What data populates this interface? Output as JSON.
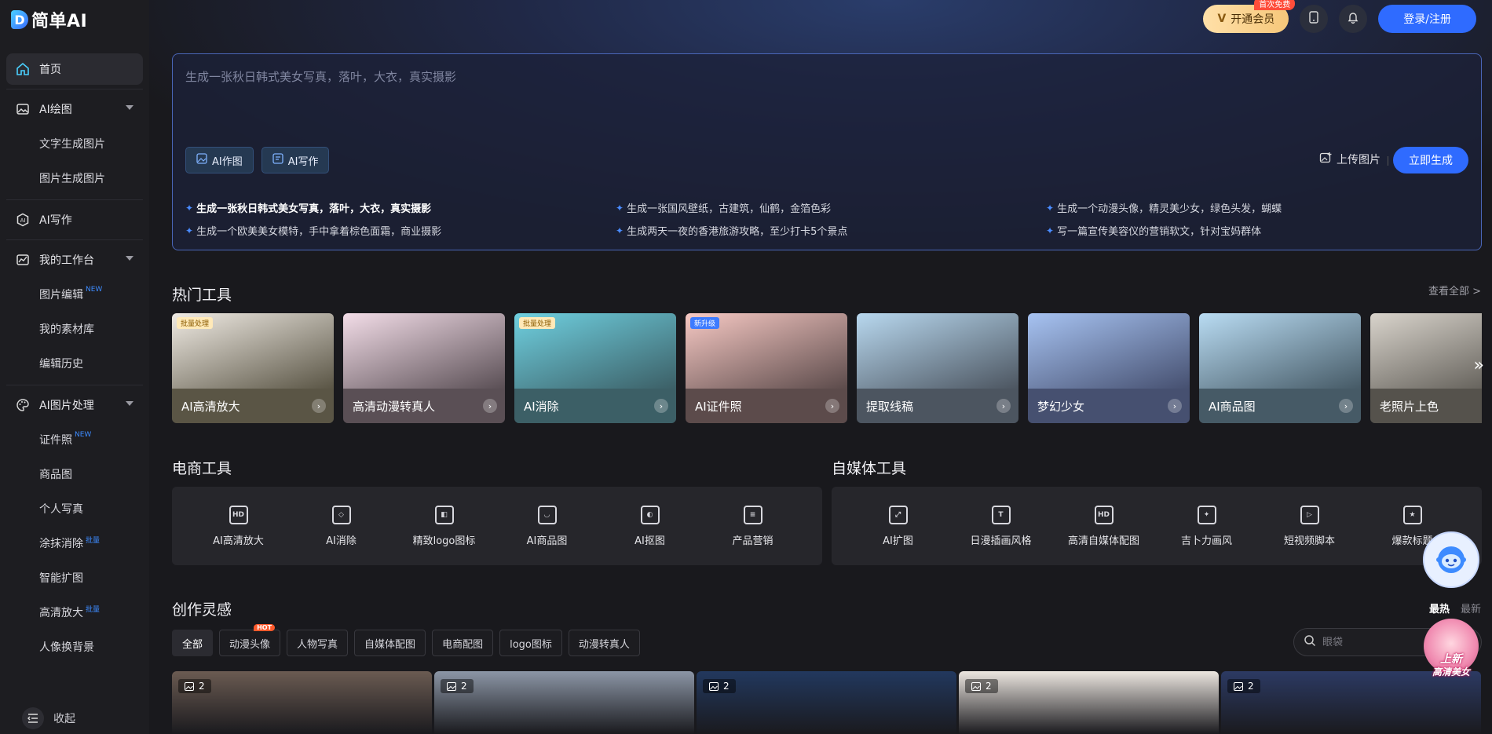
{
  "app": {
    "logo_mark": "D",
    "logo_text": "简单AI"
  },
  "topbar": {
    "vip_label": "开通会员",
    "vip_badge": "首次免费",
    "login_label": "登录/注册"
  },
  "sidebar": {
    "home": "首页",
    "groups": [
      {
        "label": "AI绘图",
        "items": [
          {
            "label": "文字生成图片"
          },
          {
            "label": "图片生成图片"
          }
        ]
      },
      {
        "label": "AI写作"
      },
      {
        "label": "我的工作台",
        "items": [
          {
            "label": "图片编辑",
            "tag": "NEW"
          },
          {
            "label": "我的素材库"
          },
          {
            "label": "编辑历史"
          }
        ]
      },
      {
        "label": "AI图片处理",
        "items": [
          {
            "label": "证件照",
            "tag": "NEW"
          },
          {
            "label": "商品图"
          },
          {
            "label": "个人写真"
          },
          {
            "label": "涂抹消除",
            "tag": "批量"
          },
          {
            "label": "智能扩图"
          },
          {
            "label": "高清放大",
            "tag": "批量"
          },
          {
            "label": "人像换背景"
          }
        ]
      }
    ],
    "collapse_label": "收起"
  },
  "prompt": {
    "placeholder": "生成一张秋日韩式美女写真，落叶，大衣，真实摄影",
    "modes": [
      "AI作图",
      "AI写作"
    ],
    "upload_label": "上传图片",
    "generate_label": "立即生成",
    "suggestions": [
      "生成一张秋日韩式美女写真，落叶，大衣，真实摄影",
      "生成一张国风壁纸，古建筑，仙鹤，金箔色彩",
      "生成一个动漫头像，精灵美少女，绿色头发，蝴蝶",
      "生成一个欧美美女模特，手中拿着棕色面霜，商业摄影",
      "生成两天一夜的香港旅游攻略，至少打卡5个景点",
      "写一篇宣传美容仪的营销软文，针对宝妈群体"
    ]
  },
  "hot_tools": {
    "title": "热门工具",
    "see_all": "查看全部 >",
    "cards": [
      {
        "label": "AI高清放大",
        "badge": "批量处理",
        "bg": "#f0ebe4",
        "band": "#5a5545"
      },
      {
        "label": "高清动漫转真人",
        "badge": "",
        "bg": "#f3dde8",
        "band": "#5a4f55"
      },
      {
        "label": "AI消除",
        "badge": "批量处理",
        "bg": "#6fd0e0",
        "band": "#3c5f66"
      },
      {
        "label": "AI证件照",
        "badge": "新升级",
        "bg": "#f7c9c4",
        "band": "#5c4b4b"
      },
      {
        "label": "提取线稿",
        "badge": "",
        "bg": "#b8d8ef",
        "band": "#4c5560"
      },
      {
        "label": "梦幻少女",
        "badge": "",
        "bg": "#a7c3f2",
        "band": "#465070"
      },
      {
        "label": "AI商品图",
        "badge": "",
        "bg": "#b9dcf3",
        "band": "#465a66"
      },
      {
        "label": "老照片上色",
        "badge": "",
        "bg": "#d9d4cc",
        "band": "#55524c"
      }
    ]
  },
  "ecommerce": {
    "title": "电商工具",
    "items": [
      {
        "label": "AI高清放大",
        "icon": "HD"
      },
      {
        "label": "AI消除",
        "icon": "◇"
      },
      {
        "label": "精致logo图标",
        "icon": "◧"
      },
      {
        "label": "AI商品图",
        "icon": "◡"
      },
      {
        "label": "AI抠图",
        "icon": "◐"
      },
      {
        "label": "产品营销",
        "icon": "≡"
      }
    ]
  },
  "media": {
    "title": "自媒体工具",
    "items": [
      {
        "label": "AI扩图",
        "icon": "⤢"
      },
      {
        "label": "日漫插画风格",
        "icon": "T"
      },
      {
        "label": "高清自媒体配图",
        "icon": "HD"
      },
      {
        "label": "吉卜力画风",
        "icon": "✦"
      },
      {
        "label": "短视频脚本",
        "icon": "▷"
      },
      {
        "label": "爆款标题",
        "icon": "★"
      }
    ]
  },
  "inspiration": {
    "title": "创作灵感",
    "sort": [
      "最热",
      "最新"
    ],
    "filters": [
      {
        "label": "全部",
        "hot": ""
      },
      {
        "label": "动漫头像",
        "hot": "HOT"
      },
      {
        "label": "人物写真",
        "hot": ""
      },
      {
        "label": "自媒体配图",
        "hot": ""
      },
      {
        "label": "电商配图",
        "hot": ""
      },
      {
        "label": "logo图标",
        "hot": ""
      },
      {
        "label": "动漫转真人",
        "hot": ""
      }
    ],
    "search_placeholder": "眼袋",
    "gallery": [
      {
        "count": "2",
        "bg": "#6b5b52"
      },
      {
        "count": "2",
        "bg": "#8c96a6"
      },
      {
        "count": "2",
        "bg": "#22385e"
      },
      {
        "count": "2",
        "bg": "#ece6e0"
      },
      {
        "count": "2",
        "bg": "#2c3a63"
      }
    ]
  },
  "promo": {
    "line1": "上新",
    "line2": "高清美女"
  },
  "colors": {
    "accent": "#2f6bff",
    "vip": "#f6c77a",
    "border": "#4a66b8"
  }
}
